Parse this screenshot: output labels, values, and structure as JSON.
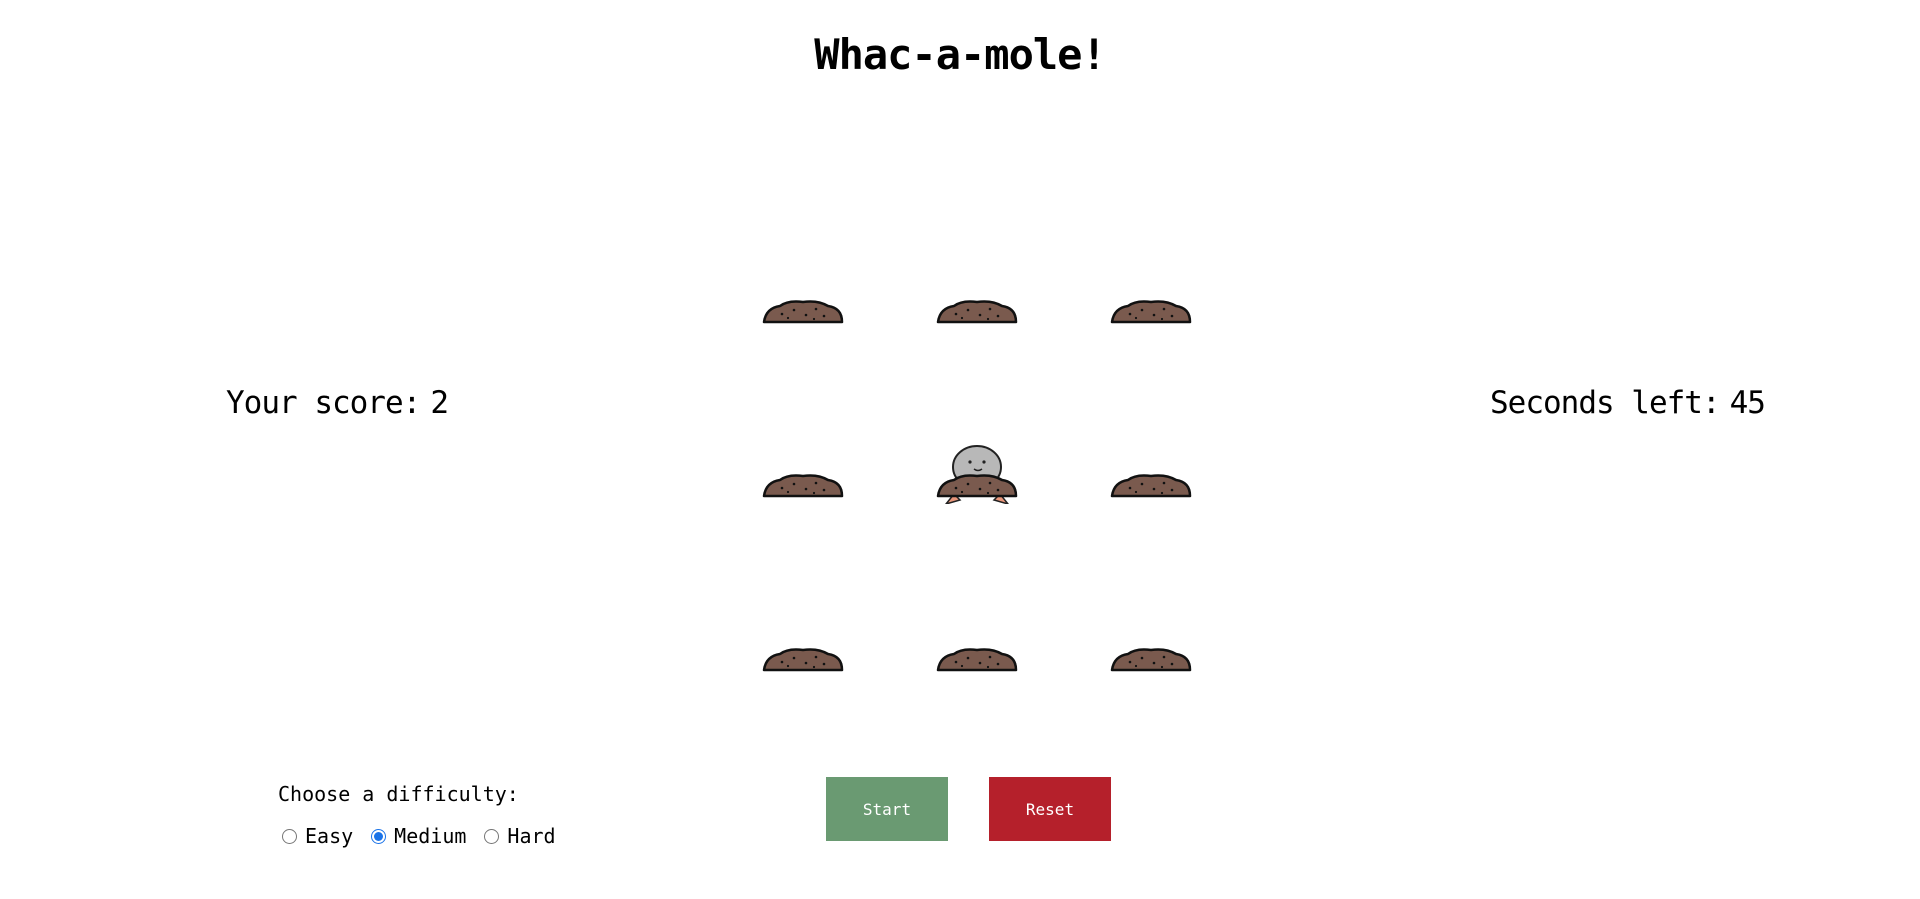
{
  "title": "Whac-a-mole!",
  "score": {
    "label": "Your score:",
    "value": "2"
  },
  "timer": {
    "label": "Seconds left:",
    "value": "45"
  },
  "board": {
    "holes": [
      {
        "mole": false
      },
      {
        "mole": false
      },
      {
        "mole": false
      },
      {
        "mole": false
      },
      {
        "mole": true
      },
      {
        "mole": false
      },
      {
        "mole": false
      },
      {
        "mole": false
      },
      {
        "mole": false
      }
    ]
  },
  "difficulty": {
    "label": "Choose a difficulty:",
    "options": [
      "Easy",
      "Medium",
      "Hard"
    ],
    "selected": "Medium"
  },
  "buttons": {
    "start": "Start",
    "reset": "Reset"
  },
  "colors": {
    "start": "#6a9a72",
    "reset": "#b5202b",
    "dirt": "#7a5a4e",
    "mole": "#b8b8b8"
  }
}
